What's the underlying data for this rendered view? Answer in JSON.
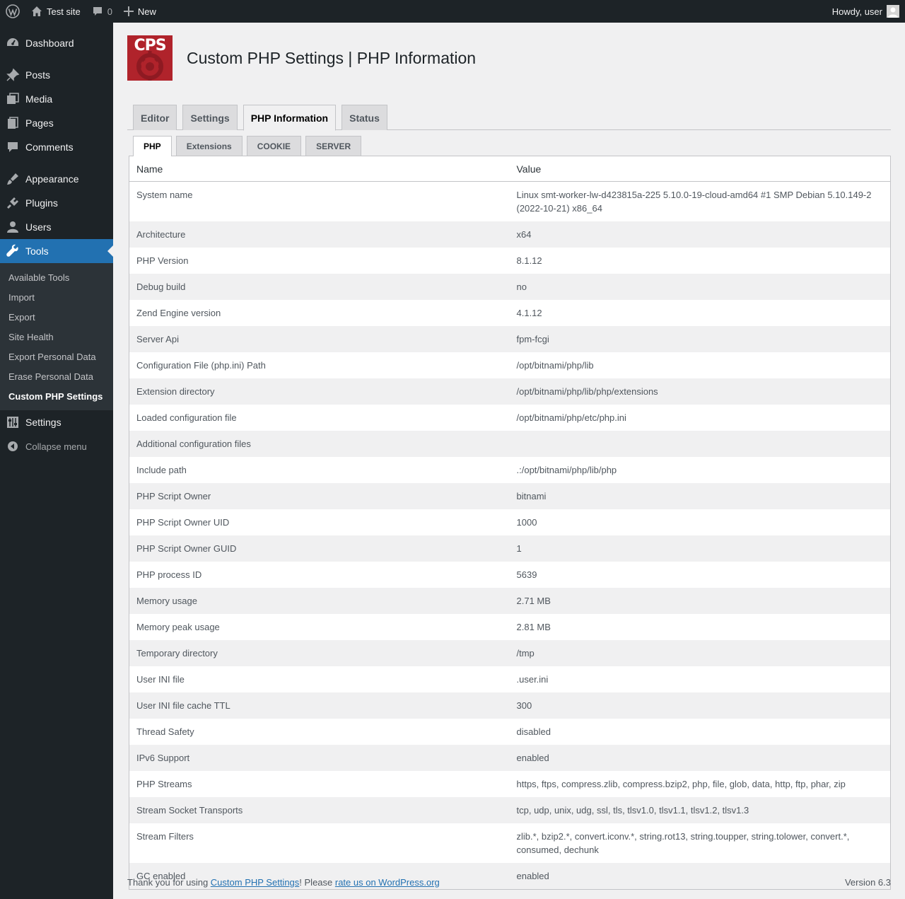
{
  "adminbar": {
    "site_name": "Test site",
    "comments_count": "0",
    "new_label": "New",
    "howdy": "Howdy, user"
  },
  "sidebar": {
    "items": [
      {
        "label": "Dashboard",
        "icon": "dashboard-icon"
      },
      {
        "label": "Posts",
        "icon": "pin-icon"
      },
      {
        "label": "Media",
        "icon": "media-icon"
      },
      {
        "label": "Pages",
        "icon": "pages-icon"
      },
      {
        "label": "Comments",
        "icon": "comment-icon"
      },
      {
        "label": "Appearance",
        "icon": "brush-icon"
      },
      {
        "label": "Plugins",
        "icon": "plugin-icon"
      },
      {
        "label": "Users",
        "icon": "user-icon"
      },
      {
        "label": "Tools",
        "icon": "wrench-icon"
      },
      {
        "label": "Settings",
        "icon": "settings-icon"
      }
    ],
    "submenu": [
      "Available Tools",
      "Import",
      "Export",
      "Site Health",
      "Export Personal Data",
      "Erase Personal Data",
      "Custom PHP Settings"
    ],
    "collapse_label": "Collapse menu"
  },
  "header": {
    "logo_text": "CPS",
    "title": "Custom PHP Settings | PHP Information"
  },
  "tabs": [
    "Editor",
    "Settings",
    "PHP Information",
    "Status"
  ],
  "subtabs": [
    "PHP",
    "Extensions",
    "COOKIE",
    "SERVER"
  ],
  "table": {
    "columns": [
      "Name",
      "Value"
    ],
    "rows": [
      [
        "System name",
        "Linux smt-worker-lw-d423815a-225 5.10.0-19-cloud-amd64 #1 SMP Debian 5.10.149-2 (2022-10-21) x86_64"
      ],
      [
        "Architecture",
        "x64"
      ],
      [
        "PHP Version",
        "8.1.12"
      ],
      [
        "Debug build",
        "no"
      ],
      [
        "Zend Engine version",
        "4.1.12"
      ],
      [
        "Server Api",
        "fpm-fcgi"
      ],
      [
        "Configuration File (php.ini) Path",
        "/opt/bitnami/php/lib"
      ],
      [
        "Extension directory",
        "/opt/bitnami/php/lib/php/extensions"
      ],
      [
        "Loaded configuration file",
        "/opt/bitnami/php/etc/php.ini"
      ],
      [
        "Additional configuration files",
        ""
      ],
      [
        "Include path",
        ".:/opt/bitnami/php/lib/php"
      ],
      [
        "PHP Script Owner",
        "bitnami"
      ],
      [
        "PHP Script Owner UID",
        "1000"
      ],
      [
        "PHP Script Owner GUID",
        "1"
      ],
      [
        "PHP process ID",
        "5639"
      ],
      [
        "Memory usage",
        "2.71 MB"
      ],
      [
        "Memory peak usage",
        "2.81 MB"
      ],
      [
        "Temporary directory",
        "/tmp"
      ],
      [
        "User INI file",
        ".user.ini"
      ],
      [
        "User INI file cache TTL",
        "300"
      ],
      [
        "Thread Safety",
        "disabled"
      ],
      [
        "IPv6 Support",
        "enabled"
      ],
      [
        "PHP Streams",
        "https, ftps, compress.zlib, compress.bzip2, php, file, glob, data, http, ftp, phar, zip"
      ],
      [
        "Stream Socket Transports",
        "tcp, udp, unix, udg, ssl, tls, tlsv1.0, tlsv1.1, tlsv1.2, tlsv1.3"
      ],
      [
        "Stream Filters",
        "zlib.*, bzip2.*, convert.iconv.*, string.rot13, string.toupper, string.tolower, convert.*, consumed, dechunk"
      ],
      [
        "GC enabled",
        "enabled"
      ]
    ]
  },
  "footer": {
    "thanks_prefix": "Thank you for using ",
    "plugin_link": "Custom PHP Settings",
    "middle": "! Please ",
    "rate_link": "rate us on WordPress.org",
    "version": "Version 6.3"
  }
}
